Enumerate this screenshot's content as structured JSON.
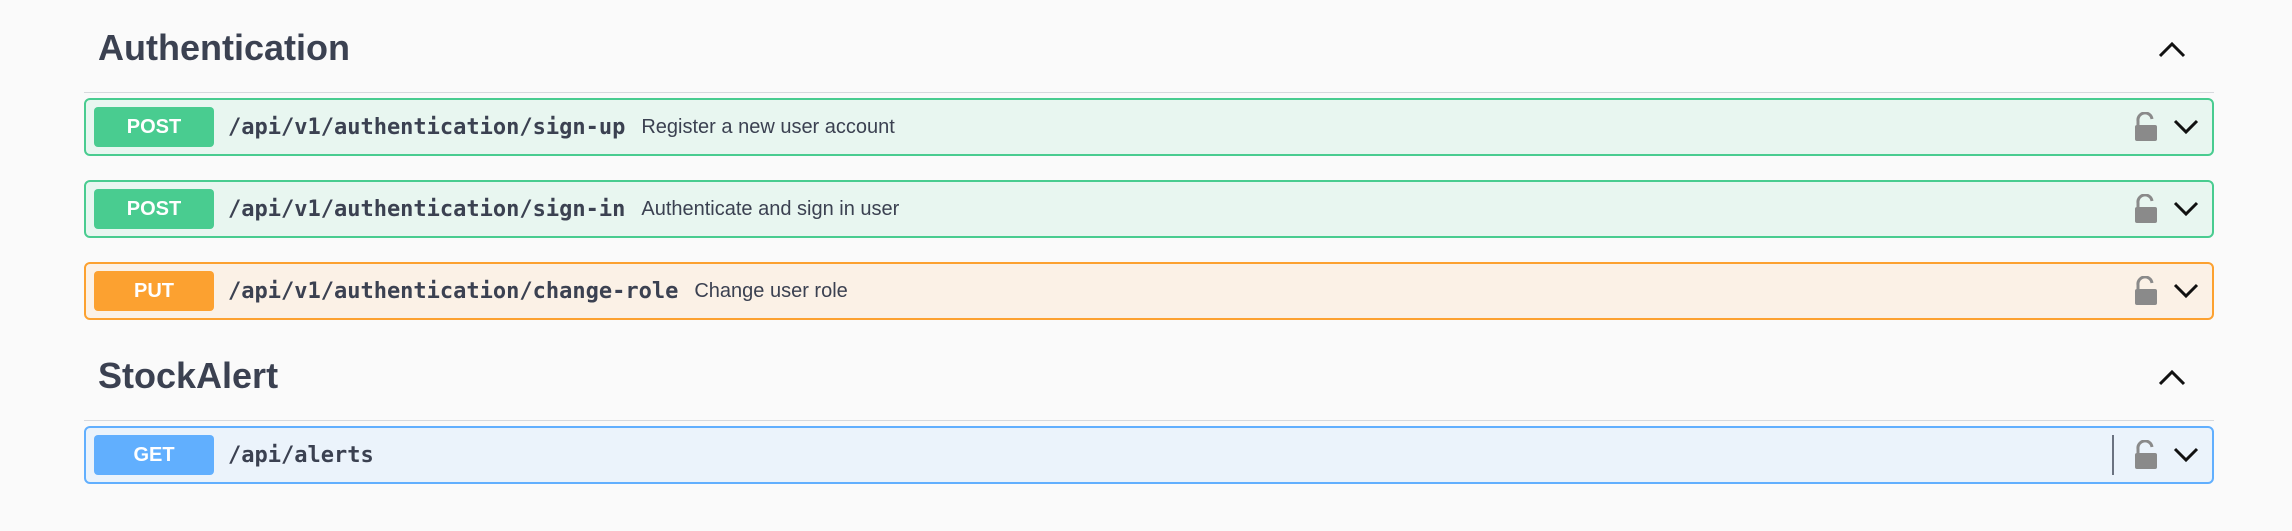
{
  "sections": [
    {
      "title": "Authentication",
      "operations": [
        {
          "method": "POST",
          "path": "/api/v1/authentication/sign-up",
          "summary": "Register a new user account"
        },
        {
          "method": "POST",
          "path": "/api/v1/authentication/sign-in",
          "summary": "Authenticate and sign in user"
        },
        {
          "method": "PUT",
          "path": "/api/v1/authentication/change-role",
          "summary": "Change user role"
        }
      ]
    },
    {
      "title": "StockAlert",
      "operations": [
        {
          "method": "GET",
          "path": "/api/alerts",
          "summary": ""
        }
      ]
    }
  ],
  "icons": {
    "collapse": "chevron-up-icon",
    "expand": "chevron-down-icon",
    "lock": "unlock-icon"
  },
  "colors": {
    "post": "#49cc90",
    "put": "#fca130",
    "get": "#61affe",
    "text": "#3b4151"
  }
}
